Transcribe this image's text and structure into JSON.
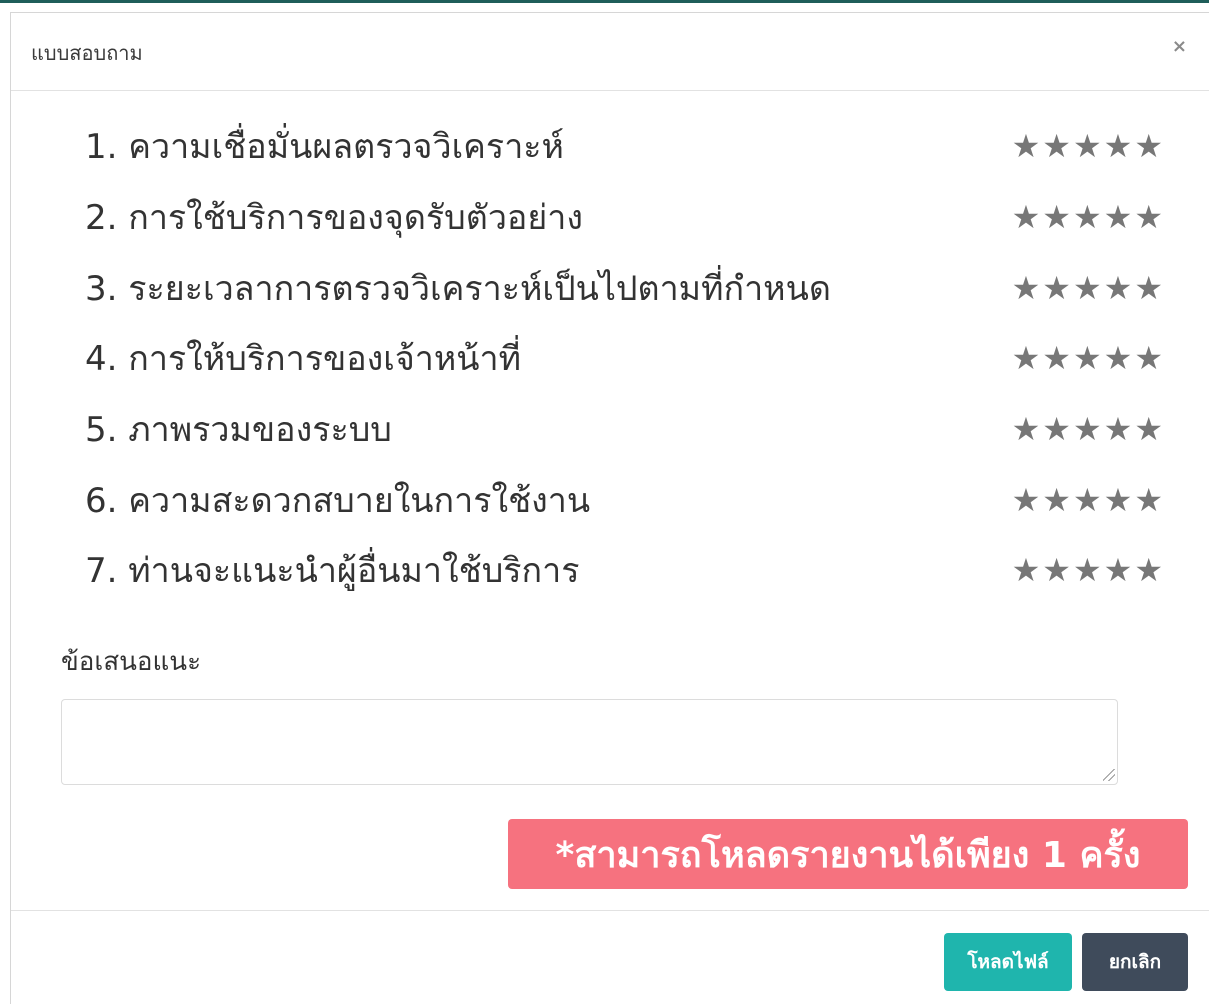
{
  "modal": {
    "title": "แบบสอบถาม",
    "close_symbol": "×"
  },
  "questions": [
    {
      "label": "1. ความเชื่อมั่นผลตรวจวิเคราะห์",
      "rating": 0,
      "max": 5
    },
    {
      "label": "2. การใช้บริการของจุดรับตัวอย่าง",
      "rating": 0,
      "max": 5
    },
    {
      "label": "3. ระยะเวลาการตรวจวิเคราะห์เป็นไปตามที่กำหนด",
      "rating": 0,
      "max": 5
    },
    {
      "label": "4. การให้บริการของเจ้าหน้าที่",
      "rating": 0,
      "max": 5
    },
    {
      "label": "5. ภาพรวมของระบบ",
      "rating": 0,
      "max": 5
    },
    {
      "label": "6. ความสะดวกสบายในการใช้งาน",
      "rating": 0,
      "max": 5
    },
    {
      "label": "7. ท่านจะแนะนำผู้อื่นมาใช้บริการ",
      "rating": 0,
      "max": 5
    }
  ],
  "star_glyph": "★",
  "suggestion": {
    "label": "ข้อเสนอแนะ",
    "value": "",
    "placeholder": ""
  },
  "warning": {
    "text": "*สามารถโหลดรายงานได้เพียง 1 ครั้ง"
  },
  "footer": {
    "download_label": "โหลดไฟล์",
    "cancel_label": "ยกเลิก"
  },
  "colors": {
    "star": "#777777",
    "warning_bg": "#f6727f",
    "download_bg": "#1fb5ad",
    "cancel_bg": "#3f4b5b"
  }
}
